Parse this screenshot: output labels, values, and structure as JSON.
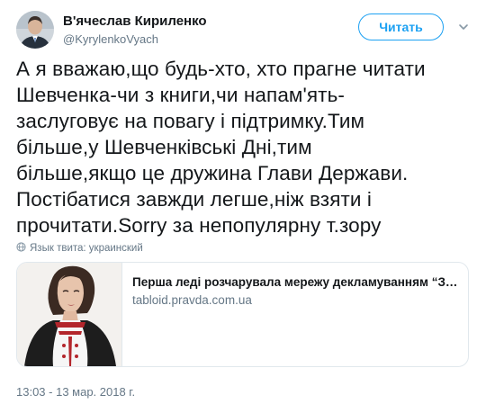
{
  "author": {
    "name": "В'ячеслав Кириленко",
    "handle": "@KyrylenkoVyach",
    "avatar_icon": "user-avatar"
  },
  "follow_button": {
    "label": "Читать"
  },
  "menu_icon": "chevron-down-icon",
  "tweet": {
    "text_lines": [
      "А я вважаю,що будь-хто, хто прагне читати",
      "Шевченка-чи з книги,чи напам'ять-",
      "заслуговує на повагу і підтримку.Тим",
      "більше,у Шевченківські Дні,тим",
      "більше,якщо це дружина Глави Держави.",
      "Постібатися завжди легше,ніж взяти і",
      "прочитати.Sorry за непопулярну т.зору"
    ],
    "language": "Язык твита: украинский",
    "timestamp": "13:03 - 13 мар. 2018 г."
  },
  "card": {
    "title": "Перша леді розчарувала мережу декламуванням “Запов…",
    "domain": "tabloid.pravda.com.ua",
    "image_icon": "article-thumbnail"
  },
  "colors": {
    "accent": "#1da1f2",
    "text": "#14171a",
    "secondary": "#657786",
    "border": "#e1e8ed"
  }
}
